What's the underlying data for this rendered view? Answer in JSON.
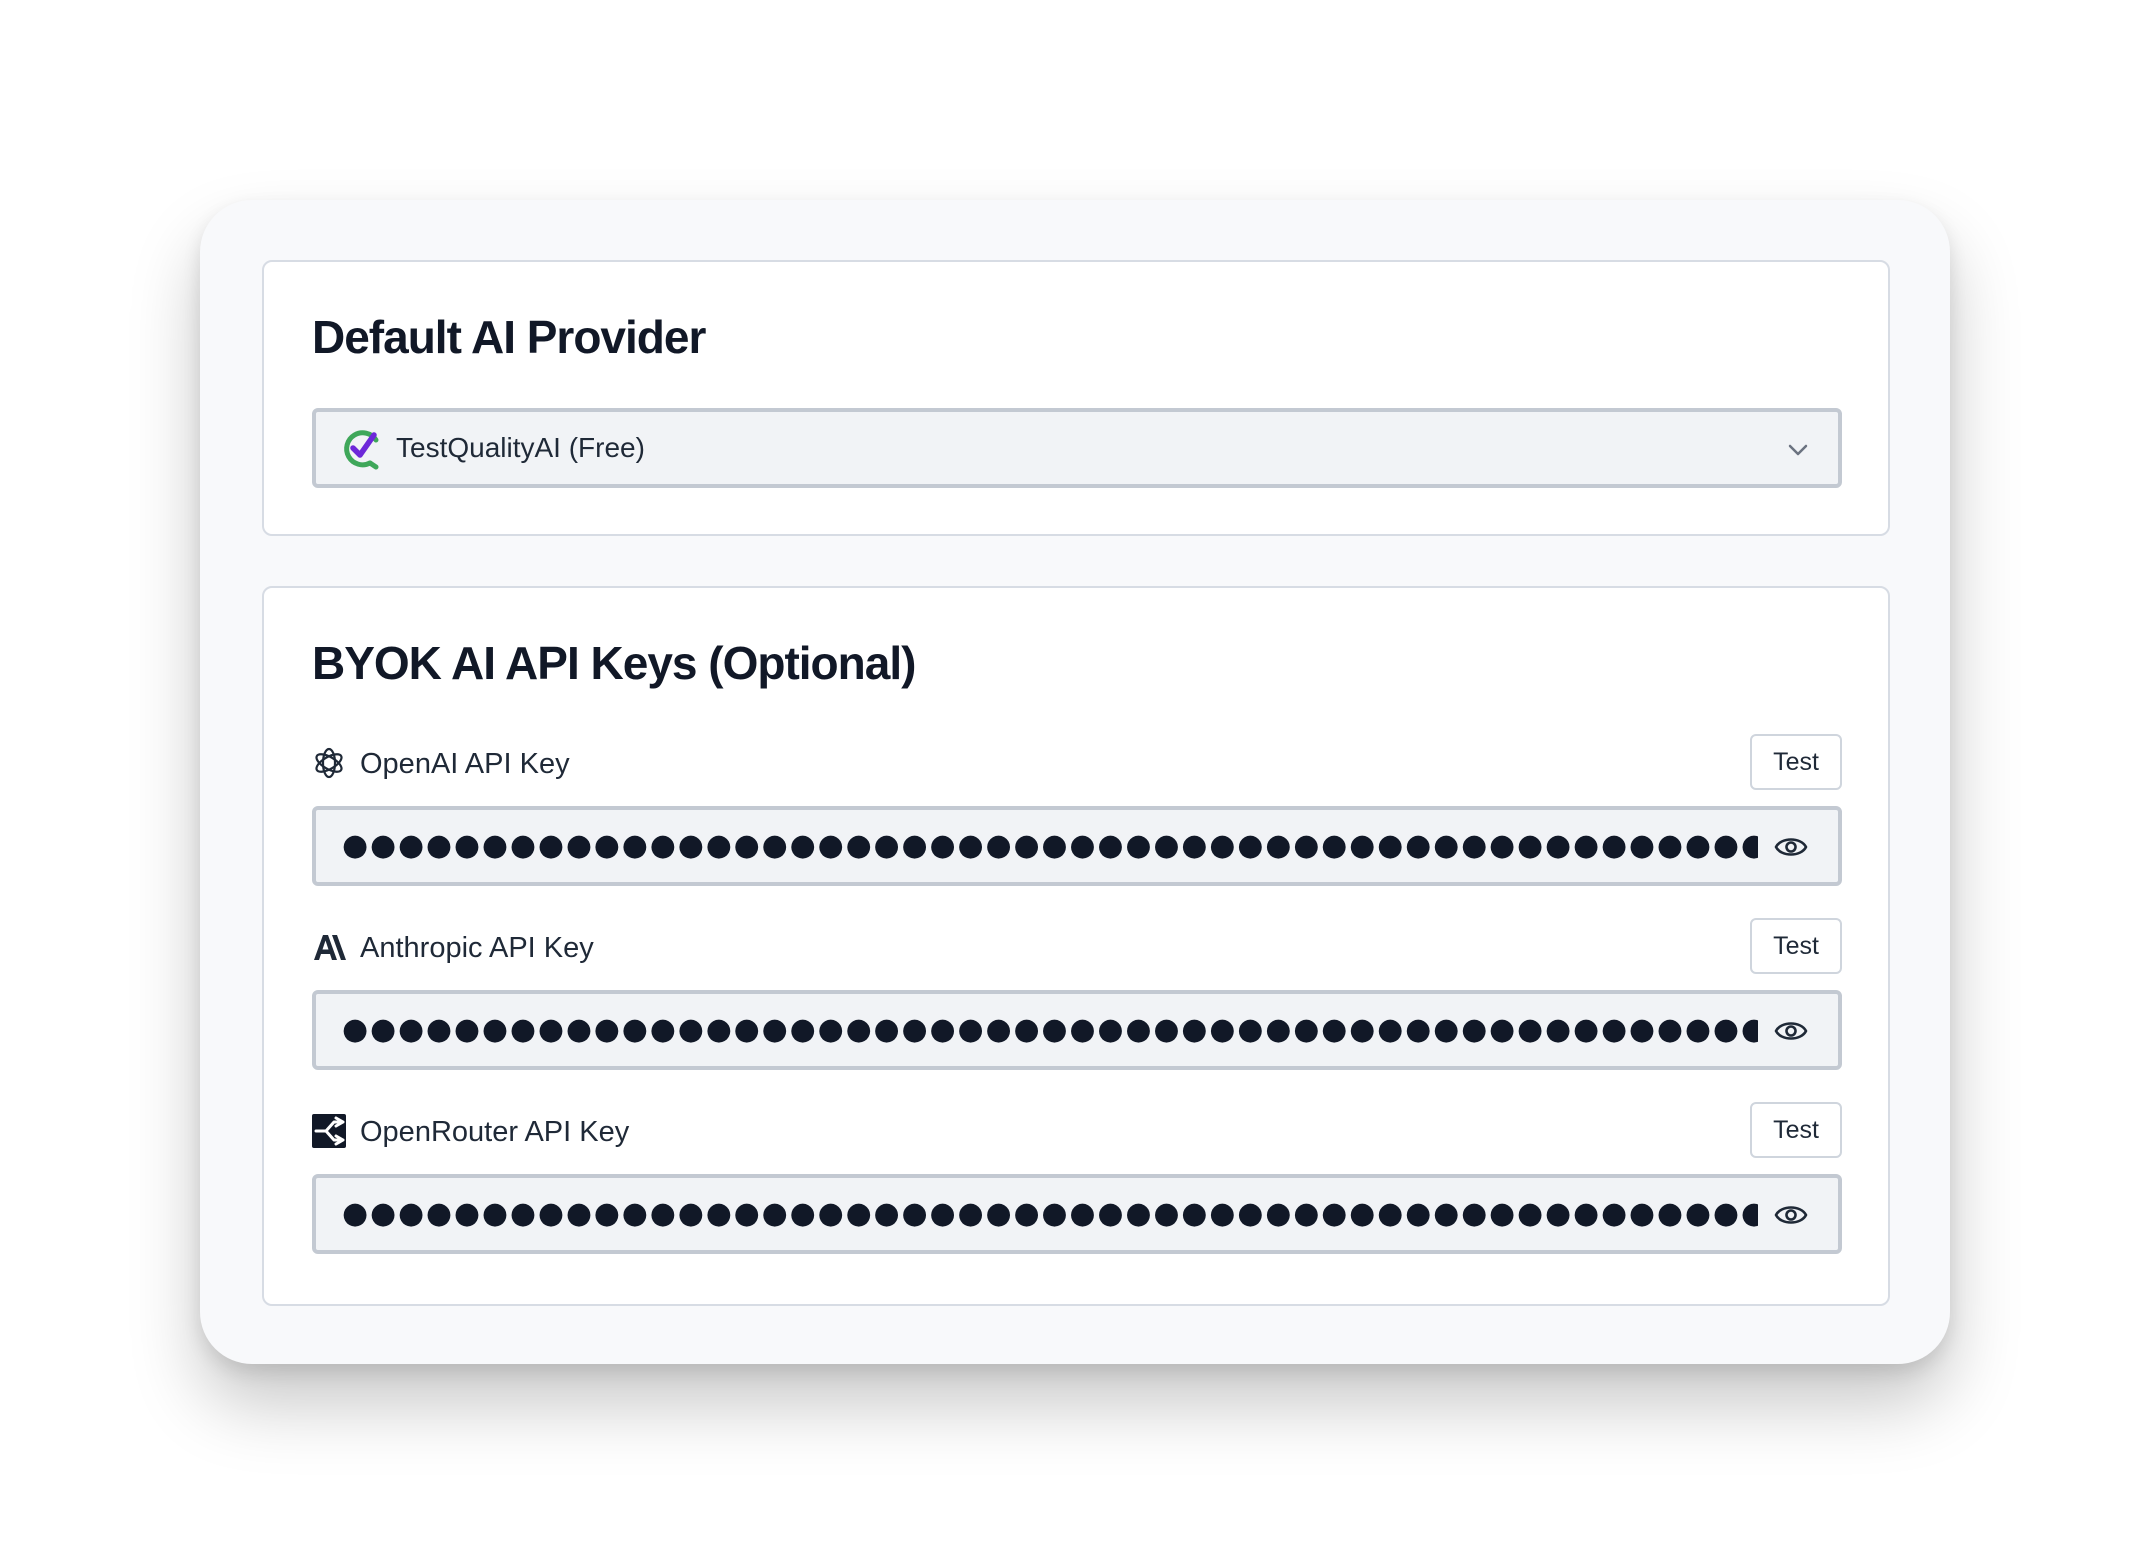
{
  "provider_section": {
    "title": "Default AI Provider",
    "selected_value": "TestQualityAI (Free)",
    "selected_icon": "testquality-check-icon"
  },
  "keys_section": {
    "title": "BYOK AI API Keys (Optional)",
    "keys": [
      {
        "label": "OpenAI API Key",
        "icon": "openai-icon",
        "test_label": "Test",
        "masked_value": "●●●●●●●●●●●●●●●●●●●●●●●●●●●●●●●●●●●●●●●●●●●●●●●●●●●●●●●●●●●●●●●●●●●●●●●●●●●●●●●●●●●●●●●●●●●●●●●●●●●●●●●●●●●●●●●●●●●●●●●●●●●●●●●●●●●●"
      },
      {
        "label": "Anthropic API Key",
        "icon": "anthropic-icon",
        "test_label": "Test",
        "masked_value": "●●●●●●●●●●●●●●●●●●●●●●●●●●●●●●●●●●●●●●●●●●●●●●●●●●●●●●●●●●●●●●●●●●●●●●●●●●●●●●●●●●●●●●●●●●●●●●●●●●●●●●●●●●●●●●●●●●●●●●●●●●●●●●●●●●●●"
      },
      {
        "label": "OpenRouter API Key",
        "icon": "openrouter-icon",
        "test_label": "Test",
        "masked_value": "●●●●●●●●●●●●●●●●●●●●●●●●●●●●●●●●●●●●●●●●●●●●●●●●●●●●●●●●●●●●●●●●●●●●●●●●●●●"
      }
    ]
  },
  "colors": {
    "check_purple": "#6d28d9",
    "check_green": "#3fa75a",
    "field_bg": "#f1f3f6",
    "field_border": "#c3c9d2"
  }
}
